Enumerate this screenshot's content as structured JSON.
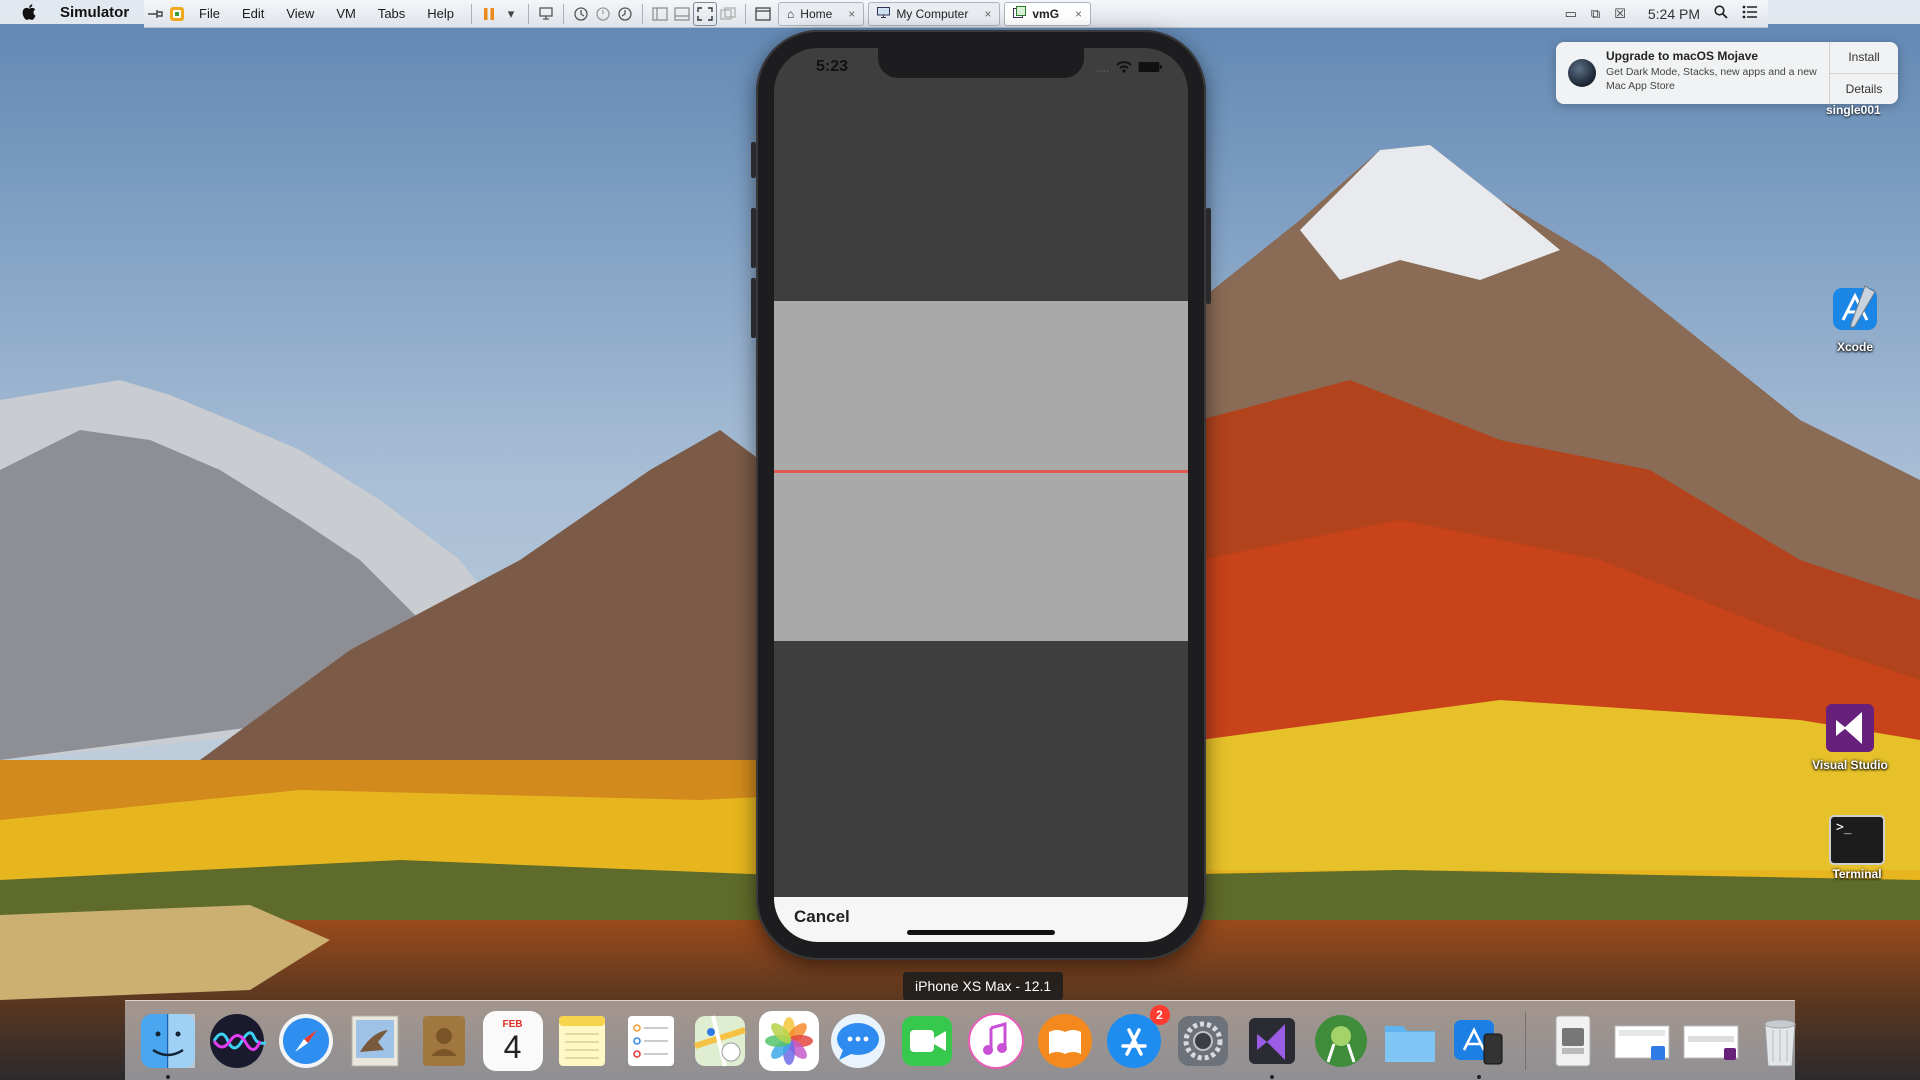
{
  "menubar": {
    "app_name": "Simulator",
    "cut_menu_fragment": "F",
    "clock": "5:24 PM"
  },
  "vm_toolbar": {
    "menus": [
      "File",
      "Edit",
      "View",
      "VM",
      "Tabs",
      "Help"
    ],
    "tabs": [
      {
        "label": "Home",
        "icon": "home-icon"
      },
      {
        "label": "My Computer",
        "icon": "computer-icon"
      },
      {
        "label": "vmG",
        "icon": "vm-icon"
      }
    ],
    "tab_close_glyph": "×"
  },
  "notification": {
    "title": "Upgrade to macOS Mojave",
    "text": "Get Dark Mode, Stacks, new apps and a new Mac App Store",
    "install_label": "Install",
    "details_label": "Details"
  },
  "desktop": {
    "partial_label": "single001",
    "icons": [
      {
        "name": "xcode",
        "label": "Xcode"
      },
      {
        "name": "visual-studio",
        "label": "Visual Studio"
      },
      {
        "name": "terminal",
        "label": "Terminal"
      }
    ],
    "terminal_prompt": ">_"
  },
  "phone": {
    "status_time": "5:23",
    "cancel_label": "Cancel",
    "colors": {
      "screen_bg": "#3e3e3e",
      "scan_zone": "#a9a9a9",
      "scan_line": "#e0584f",
      "bottom_bar": "#f6f6f6"
    }
  },
  "device_label": "iPhone XS Max - 12.1",
  "dock": {
    "calendar_month": "FEB",
    "calendar_day": "4",
    "app_store_badge": "2",
    "items": [
      "finder",
      "siri",
      "safari",
      "mail-photos",
      "contacts",
      "calendar",
      "notes",
      "reminders",
      "maps",
      "photos",
      "messages",
      "facetime",
      "itunes",
      "ibooks",
      "app-store",
      "system-preferences",
      "visual-studio",
      "android-studio",
      "folder",
      "xcode-simulator",
      "downloads-stack",
      "preview-stack",
      "window-stack",
      "trash"
    ]
  }
}
